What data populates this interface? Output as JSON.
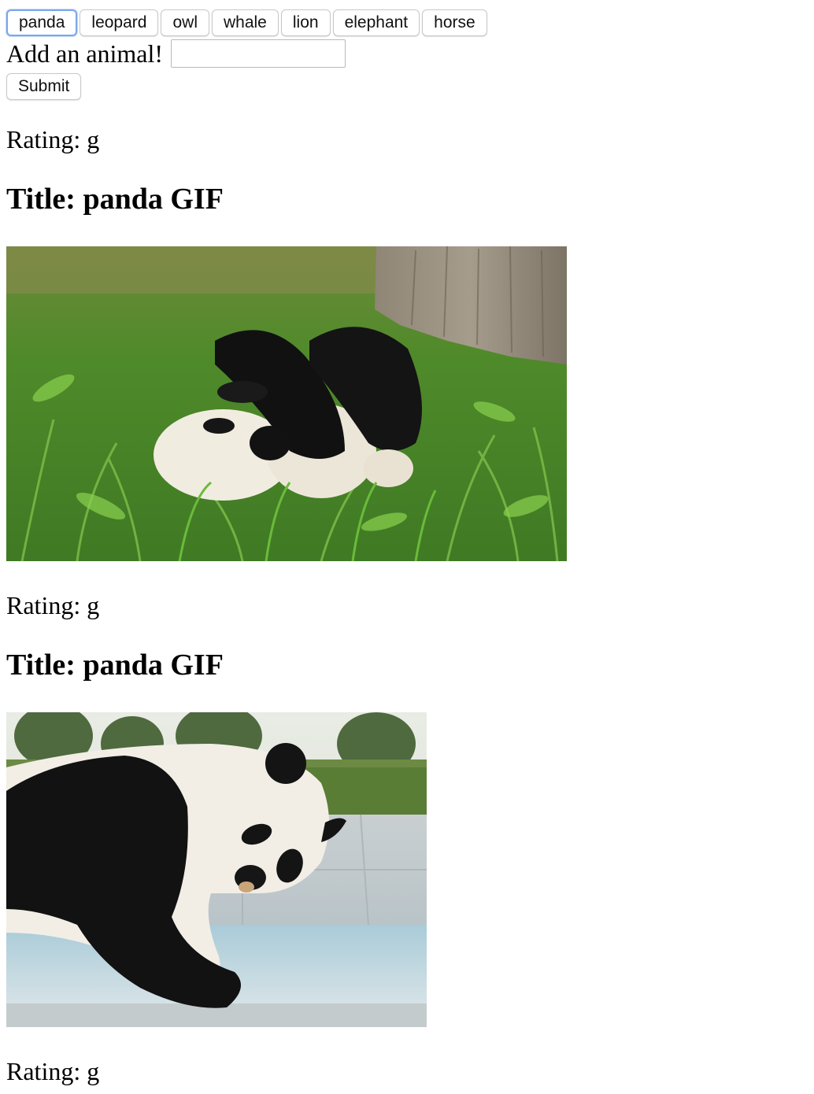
{
  "animals": [
    "panda",
    "leopard",
    "owl",
    "whale",
    "lion",
    "elephant",
    "horse"
  ],
  "form": {
    "label": "Add an animal!",
    "input_value": "",
    "submit_label": "Submit"
  },
  "results": [
    {
      "rating": "Rating: g",
      "title": "Title: panda GIF"
    },
    {
      "rating": "Rating: g",
      "title": "Title: panda GIF"
    },
    {
      "rating": "Rating: g"
    }
  ]
}
